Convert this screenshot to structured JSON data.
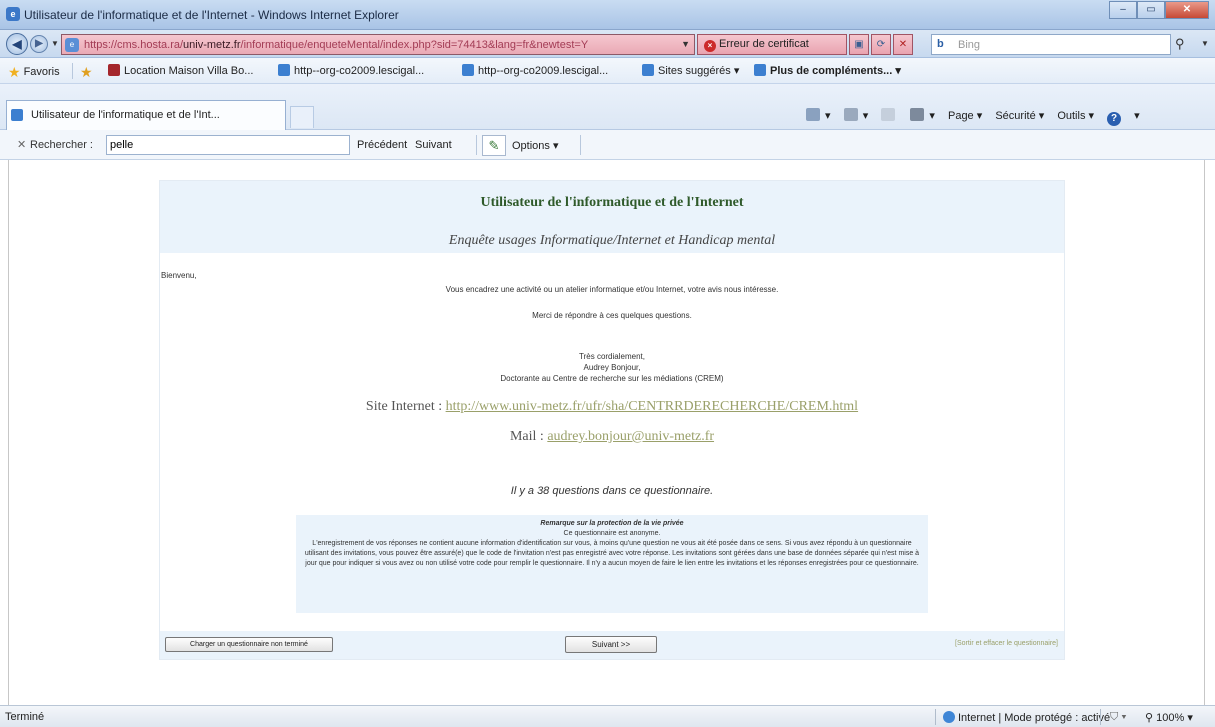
{
  "window": {
    "title": "Utilisateur de l'informatique et de l'Internet - Windows Internet Explorer",
    "minimize_icon": "minimize-icon",
    "maximize_icon": "maximize-icon",
    "close_icon": "close-icon"
  },
  "addressbar": {
    "url_prefix": "https://cms.hosta.ra/",
    "url_domain": "univ-metz.fr",
    "url_suffix": "/informatique/enqueteMental/index.php?sid=74413&lang=fr&newtest=Y",
    "cert_error": "Erreur de certificat",
    "search_provider": "b",
    "search_placeholder": "Bing"
  },
  "favorites": {
    "favoris_label": "Favoris",
    "items": [
      "Location Maison Villa Bo...",
      "http--org-co2009.lescigal...",
      "http--org-co2009.lescigal...",
      "Sites suggérés ▾",
      "Plus de compléments... ▾"
    ]
  },
  "tabs": {
    "active_label": "Utilisateur de l'informatique et de l'Int..."
  },
  "commandbar": {
    "page_label": "Page ▾",
    "security_label": "Sécurité ▾",
    "tools_label": "Outils ▾"
  },
  "findbar": {
    "label": "Rechercher :",
    "value": "pelle",
    "prev_label": "Précédent",
    "next_label": "Suivant",
    "options_label": "Options ▾"
  },
  "survey": {
    "title": "Utilisateur de l'informatique et de l'Internet",
    "subtitle": "Enquête usages Informatique/Internet et Handicap mental",
    "welcome": "Bienvenu,",
    "intro": "Vous encadrez une activité ou un atelier informatique et/ou Internet, votre avis nous intéresse.",
    "thanks": "Merci de répondre à ces quelques questions.",
    "sig_line1": "Très cordialement,",
    "sig_line2": "Audrey Bonjour,",
    "sig_line3": "Doctorante au Centre de recherche sur les médiations (CREM)",
    "site_label": "Site Internet : ",
    "site_url": "http://www.univ-metz.fr/ufr/sha/CENTRRDERECHERCHE/CREM.html",
    "mail_label": "Mail : ",
    "mail_address": "audrey.bonjour@univ-metz.fr",
    "question_count": "Il y a 38 questions dans ce questionnaire.",
    "privacy_heading": "Remarque sur la protection de la vie privée",
    "privacy_anon": "Ce questionnaire est anonyme.",
    "privacy_body": "L'enregistrement de vos réponses ne contient aucune information d'identification sur vous, à moins qu'une question ne vous ait été posée dans ce sens. Si vous avez répondu à un questionnaire utilisant des invitations, vous pouvez être assuré(e) que le code de l'invitation n'est pas enregistré avec votre réponse. Les invitations sont gérées dans une base de données séparée qui n'est mise à jour que pour indiquer si vous avez ou non utilisé votre code pour remplir le questionnaire. Il n'y a aucun moyen de faire le lien entre les invitations et les réponses enregistrées pour ce questionnaire.",
    "load_button": "Charger un questionnaire non terminé",
    "next_button": "Suivant >>",
    "exit_link": "[Sortir et effacer le questionnaire]"
  },
  "statusbar": {
    "status": "Terminé",
    "zone": "Internet | Mode protégé : activé",
    "zoom": "100%"
  }
}
